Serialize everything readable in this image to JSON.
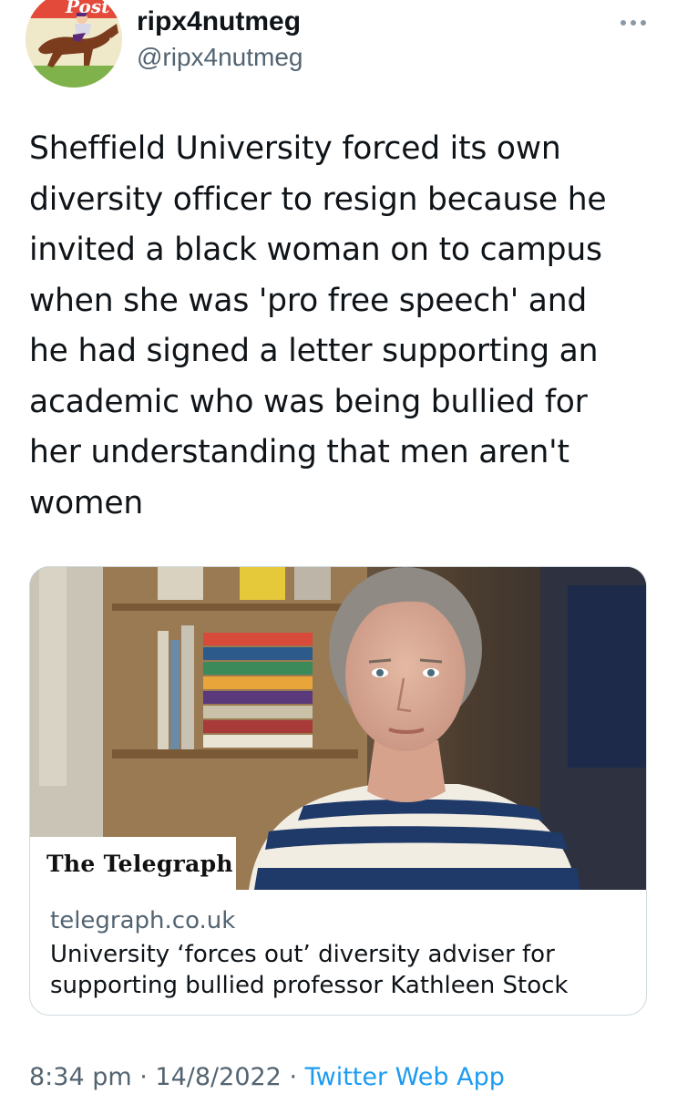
{
  "user": {
    "display_name": "ripx4nutmeg",
    "handle": "@ripx4nutmeg",
    "avatar_icon": "racehorse-jockey-avatar",
    "avatar_text": "Post"
  },
  "tweet": {
    "text": "Sheffield University forced its own\ndiversity officer to resign because he\ninvited a black woman on to campus\nwhen she was 'pro free speech' and\nhe had signed a letter supporting an\nacademic who was being bullied for\nher understanding that men aren't\nwomen"
  },
  "card": {
    "publisher": "The Telegraph",
    "domain": "telegraph.co.uk",
    "title_line1": "University ‘forces out’ diversity adviser for",
    "title_line2": "supporting bullied professor Kathleen Stock",
    "image_icon": "portrait-photo"
  },
  "footer": {
    "time": "8:34 pm",
    "separator1": " · ",
    "date": "14/8/2022",
    "separator2": " · ",
    "source": "Twitter Web App"
  },
  "colors": {
    "text_primary": "#0f1419",
    "text_secondary": "#536471",
    "link": "#1d9bf0",
    "border": "#cfd9de"
  }
}
